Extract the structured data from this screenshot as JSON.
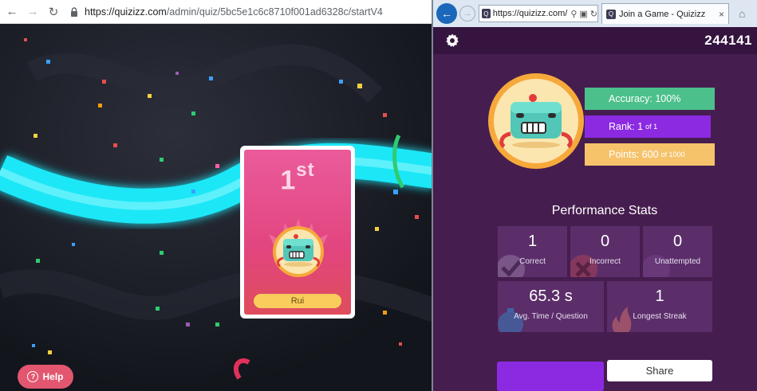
{
  "chrome": {
    "url_host": "https://quizizz.com",
    "url_path": "/admin/quiz/5bc5e1c6c8710f001ad6328c/startV4"
  },
  "leaderboard": {
    "rank_number": "1",
    "rank_suffix": "st",
    "player_name": "Rui"
  },
  "help_button": {
    "label": "Help"
  },
  "ie": {
    "address": "https://quizizz.com/",
    "tab_title": "Join a Game - Quizizz"
  },
  "quiz": {
    "game_code": "244141",
    "accuracy_text": "Accuracy: 100%",
    "rank_label": "Rank: 1",
    "rank_of": "of 1",
    "points_label": "Points: 600",
    "points_of": "of 1000",
    "performance_title": "Performance Stats",
    "stats": {
      "correct": {
        "value": "1",
        "label": "Correct"
      },
      "incorrect": {
        "value": "0",
        "label": "Incorrect"
      },
      "unattempted": {
        "value": "0",
        "label": "Unattempted"
      },
      "avg_time": {
        "value": "65.3 s",
        "label": "Avg. Time / Question"
      },
      "streak": {
        "value": "1",
        "label": "Longest Streak"
      }
    },
    "share_label": "Share"
  },
  "colors": {
    "accuracy": "#4cc08b",
    "rank": "#8c2ae2",
    "points": "#f6c36b",
    "card_pink": "#e2457f",
    "glow_cyan": "#2ff3ff"
  }
}
